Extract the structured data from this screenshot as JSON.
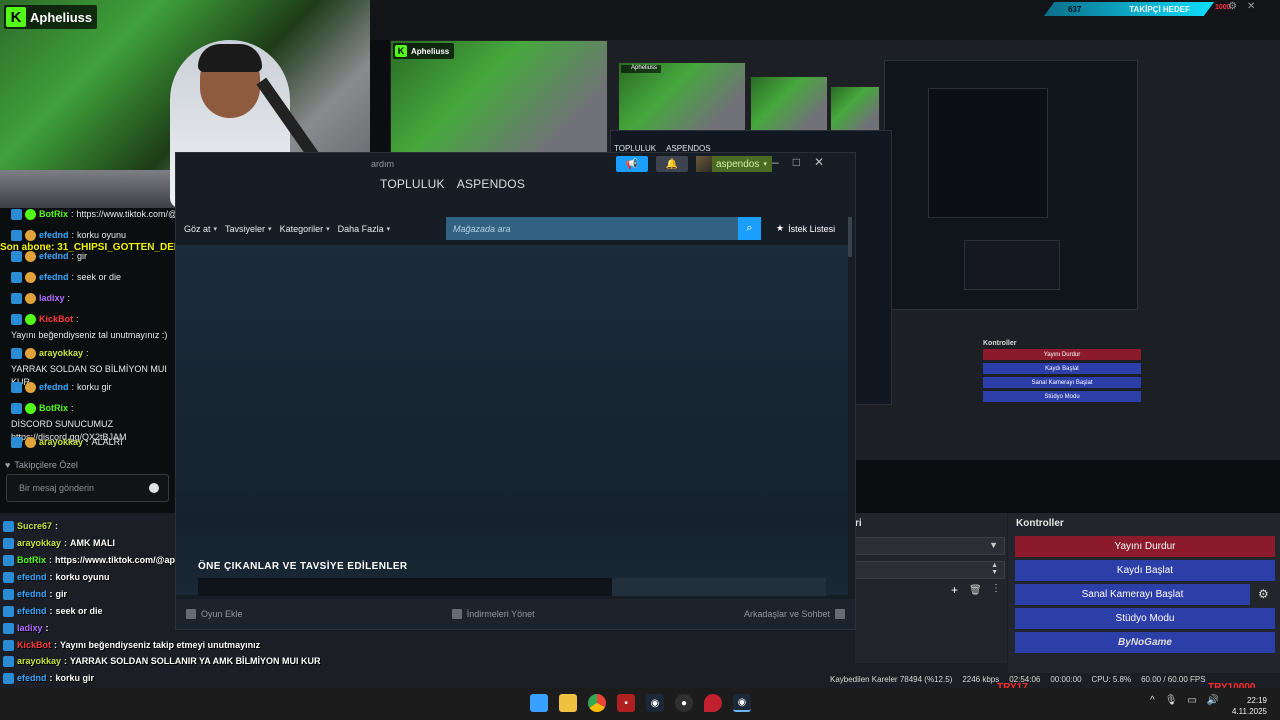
{
  "stream": {
    "channel": "Apheliuss",
    "sub_banner": "Son abone: 31_CHIPSI_GOTTEN_DELEN_31",
    "goal_count": "637",
    "goal_label": "TAKİPÇİ HEDEF",
    "goal_end": "1000"
  },
  "steam": {
    "title_fragment": "ardım",
    "nav_community": "TOPLULUK",
    "nav_username": "ASPENDOS",
    "user_button": "aspendos",
    "menu": [
      "Göz at",
      "Tavsiyeler",
      "Kategoriler",
      "Daha Fazla"
    ],
    "search_placeholder": "Mağazada ara",
    "wishlist": "İstek Listesi",
    "featured_title": "ÖNE ÇIKANLAR VE TAVSİYE EDİLENLER",
    "footer_add_game": "Oyun Ekle",
    "footer_downloads": "İndirmeleri Yönet",
    "footer_friends": "Arkadaşlar ve Sohbet"
  },
  "chat": {
    "lines": [
      {
        "user": "BotRix",
        "text": "https://www.tiktok.com/@",
        "color": "u-green"
      },
      {
        "user": "efednd",
        "text": "korku oyunu",
        "color": "u-blue"
      },
      {
        "user": "efednd",
        "text": "gir",
        "color": "u-blue"
      },
      {
        "user": "efednd",
        "text": "seek or die",
        "color": "u-blue"
      },
      {
        "user": "ladixy",
        "text": "",
        "color": "u-purple"
      },
      {
        "user": "KickBot",
        "text": "Yayını beğendiyseniz tal unutmayınız :)",
        "color": "u-red"
      },
      {
        "user": "arayokkay",
        "text": "YARRAK SOLDAN SO BİLMİYON MUI KUR",
        "color": "u-yellow"
      },
      {
        "user": "efednd",
        "text": "korku gir",
        "color": "u-blue"
      },
      {
        "user": "BotRix",
        "text": "DİSCORD SUNUCUMUZ https://discord.gg/QX2tBJAM",
        "color": "u-green"
      },
      {
        "user": "arayokkay",
        "text": "ALALRI",
        "color": "u-yellow"
      }
    ],
    "followers_label": "Takipçilere Özel",
    "input_placeholder": "Bir mesaj gönderin"
  },
  "overlay_chat": [
    {
      "user": "Sucre67",
      "text": ""
    },
    {
      "user": "arayokkay",
      "text": "AMK MALI"
    },
    {
      "user": "BotRix",
      "text": "https://www.tiktok.com/@aphelius.yt"
    },
    {
      "user": "efednd",
      "text": "korku oyunu"
    },
    {
      "user": "efednd",
      "text": "gir"
    },
    {
      "user": "efednd",
      "text": "seek or die"
    },
    {
      "user": "ladixy",
      "text": ""
    },
    {
      "user": "KickBot",
      "text": "Yayını beğendiyseniz takip etmeyi unutmayınız"
    },
    {
      "user": "arayokkay",
      "text": "YARRAK SOLDAN SOLLANIR YA AMK BİLMİYON MUI KUR"
    },
    {
      "user": "efednd",
      "text": "korku gir"
    },
    {
      "user": "BotRix",
      "text": "DİSCORD SUNUCUMUZ https://discord.gg/QX2tBJAM"
    },
    {
      "user": "arayokkay",
      "text": "ALALRI"
    }
  ],
  "obs": {
    "controls_title": "Kontroller",
    "stop_stream": "Yayını Durdur",
    "start_record": "Kaydı Başlat",
    "virtual_cam": "Sanal Kamerayı Başlat",
    "studio_mode": "Stüdyo Modu",
    "panel_fragment": "ri",
    "brand": "ByNoGame",
    "status_dropped": "Kaybedilen Kareler 78494 (%12.5)",
    "status_kbps": "2246 kbps",
    "status_time": "02:54:06",
    "status_rec": "00:00:00",
    "status_cpu": "CPU: 5.8%",
    "status_fps": "60.00 / 60.00 FPS",
    "try_left": "TRY17",
    "try_right": "TRY10000"
  },
  "taskbar": {
    "time": "22:19",
    "date": "4.11.2025"
  }
}
